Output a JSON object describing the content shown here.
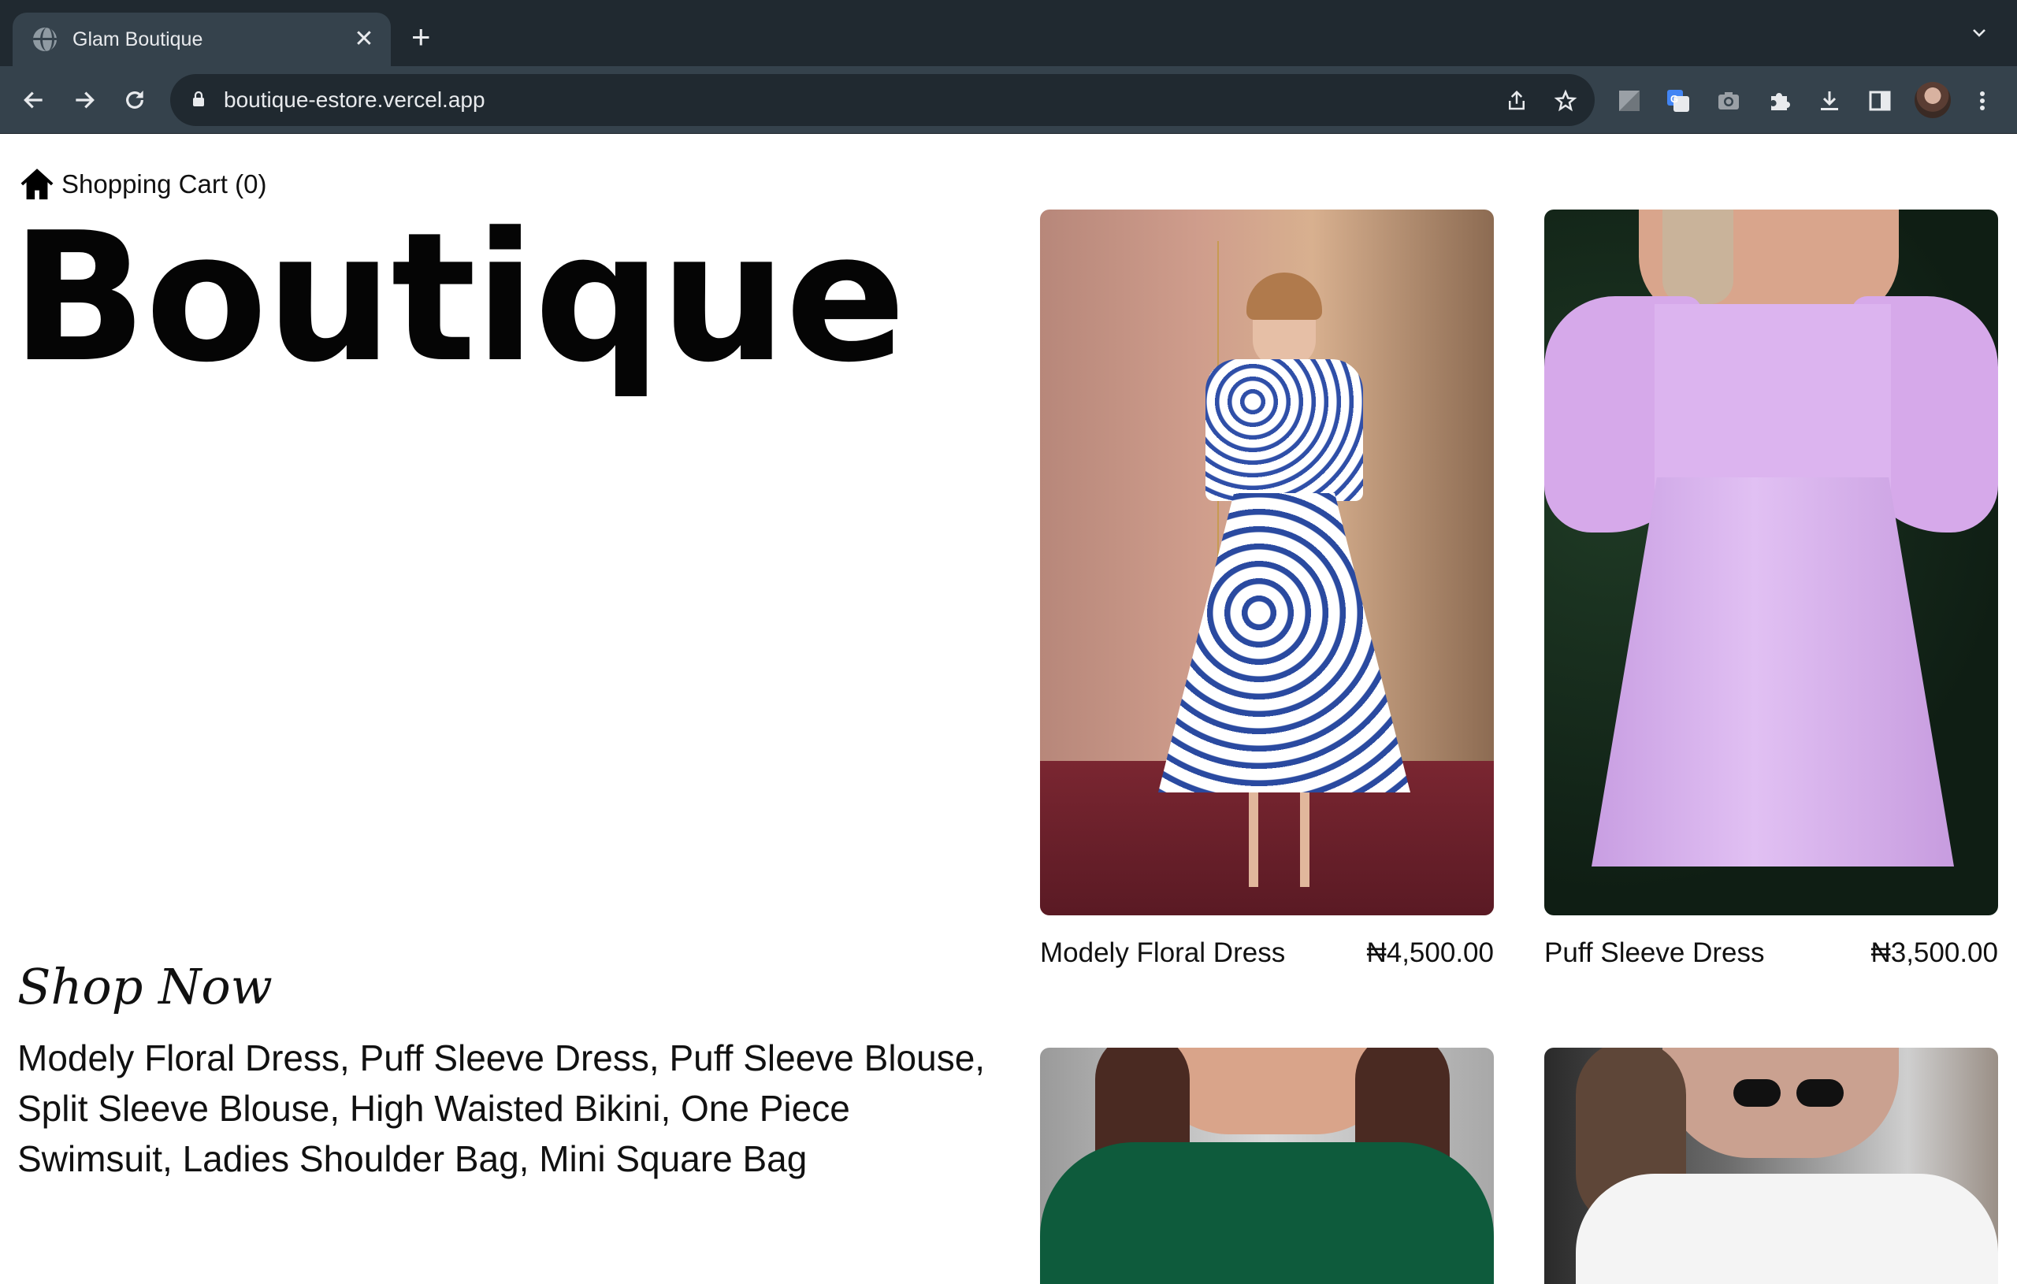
{
  "browser": {
    "tab_title": "Glam Boutique",
    "new_tab_label": "+",
    "url": "boutique-estore.vercel.app"
  },
  "header": {
    "cart_label": "Shopping Cart (0)",
    "logo_text": "Boutique"
  },
  "hero": {
    "shop_now": "Shop Now",
    "product_list_text": "Modely Floral Dress, Puff Sleeve Dress, Puff Sleeve Blouse, Split Sleeve Blouse, High Waisted Bikini, One Piece Swimsuit, Ladies Shoulder Bag, Mini Square Bag"
  },
  "products": [
    {
      "name": "Modely Floral Dress",
      "price": "₦4,500.00",
      "image": "woman-in-blue-floral-dress"
    },
    {
      "name": "Puff Sleeve Dress",
      "price": "₦3,500.00",
      "image": "woman-in-lilac-puff-sleeve-dress"
    },
    {
      "name": "",
      "price": "",
      "image": "woman-in-green-puff-sleeve-blouse"
    },
    {
      "name": "",
      "price": "",
      "image": "woman-in-white-blouse-with-sunglasses"
    }
  ],
  "colors": {
    "chrome_dark": "#202930",
    "chrome_mid": "#35424c",
    "chrome_text": "#e8eaed",
    "page_bg": "#ffffff",
    "text": "#111111"
  },
  "icons": [
    "globe-icon",
    "close-icon",
    "chevron-down-icon",
    "back-arrow-icon",
    "forward-arrow-icon",
    "reload-icon",
    "lock-icon",
    "share-icon",
    "star-icon",
    "extension-icon",
    "translate-icon",
    "camera-icon",
    "puzzle-icon",
    "download-icon",
    "sidepanel-icon",
    "kebab-menu-icon",
    "home-icon"
  ]
}
